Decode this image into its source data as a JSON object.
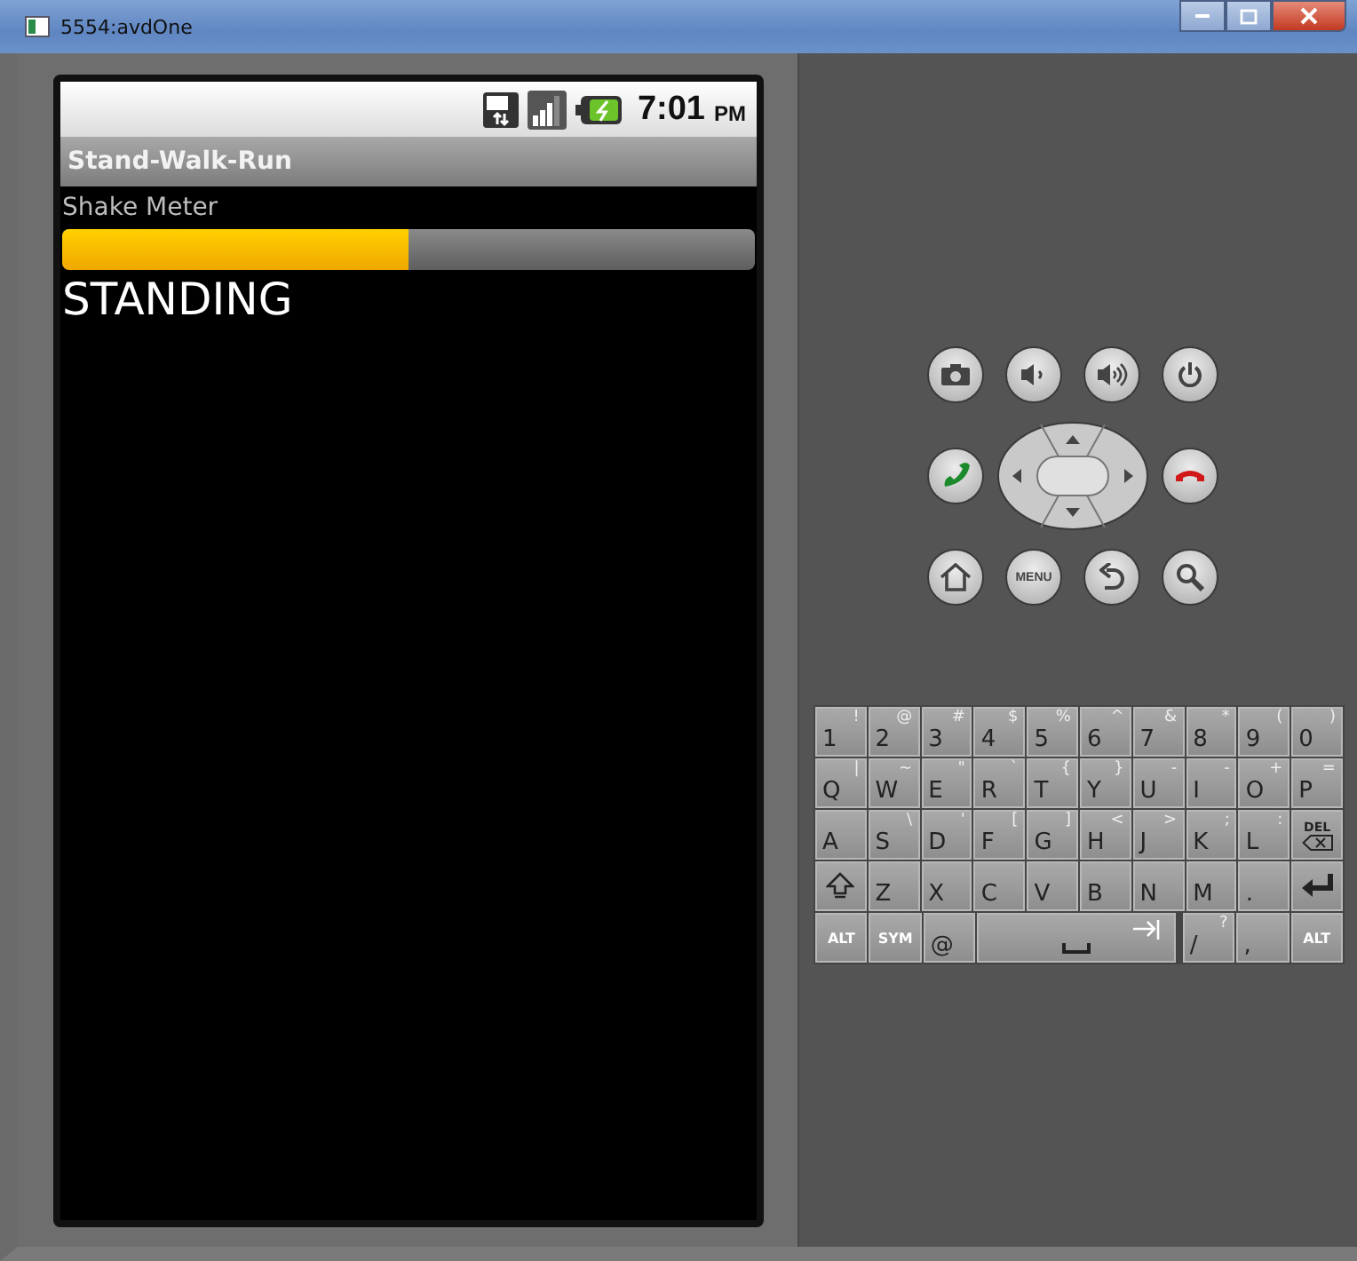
{
  "window": {
    "title": "5554:avdOne"
  },
  "status_bar": {
    "time": "7:01",
    "period": "PM"
  },
  "app_bar": {
    "title": "Stand-Walk-Run"
  },
  "meter": {
    "label": "Shake Meter",
    "level": 0.5
  },
  "activity": "STANDING",
  "hardware_keys": [
    {
      "kind": "camera"
    },
    {
      "kind": "volume_down"
    },
    {
      "kind": "volume_up"
    },
    {
      "kind": "power"
    },
    {
      "kind": "call"
    },
    {
      "kind": "dpad"
    },
    {
      "kind": "end_call"
    },
    {
      "kind": "home"
    },
    {
      "kind": "menu",
      "label": "MENU"
    },
    {
      "kind": "back"
    },
    {
      "kind": "search"
    }
  ],
  "keyboard": {
    "rows": [
      [
        {
          "kind": "char",
          "main": "1",
          "alt": "!"
        },
        {
          "kind": "char",
          "main": "2",
          "alt": "@"
        },
        {
          "kind": "char",
          "main": "3",
          "alt": "#"
        },
        {
          "kind": "char",
          "main": "4",
          "alt": "$"
        },
        {
          "kind": "char",
          "main": "5",
          "alt": "%"
        },
        {
          "kind": "char",
          "main": "6",
          "alt": "^"
        },
        {
          "kind": "char",
          "main": "7",
          "alt": "&"
        },
        {
          "kind": "char",
          "main": "8",
          "alt": "*"
        },
        {
          "kind": "char",
          "main": "9",
          "alt": "("
        },
        {
          "kind": "char",
          "main": "0",
          "alt": ")"
        }
      ],
      [
        {
          "kind": "char",
          "main": "Q",
          "alt": "|"
        },
        {
          "kind": "char",
          "main": "W",
          "alt": "~"
        },
        {
          "kind": "char",
          "main": "E",
          "alt": "\""
        },
        {
          "kind": "char",
          "main": "R",
          "alt": "`"
        },
        {
          "kind": "char",
          "main": "T",
          "alt": "{"
        },
        {
          "kind": "char",
          "main": "Y",
          "alt": "}"
        },
        {
          "kind": "char",
          "main": "U",
          "alt": "-"
        },
        {
          "kind": "char",
          "main": "I",
          "alt": "-"
        },
        {
          "kind": "char",
          "main": "O",
          "alt": "+"
        },
        {
          "kind": "char",
          "main": "P",
          "alt": "="
        }
      ],
      [
        {
          "kind": "char",
          "main": "A"
        },
        {
          "kind": "char",
          "main": "S",
          "alt": "\\"
        },
        {
          "kind": "char",
          "main": "D",
          "alt": "'"
        },
        {
          "kind": "char",
          "main": "F",
          "alt": "["
        },
        {
          "kind": "char",
          "main": "G",
          "alt": "]"
        },
        {
          "kind": "char",
          "main": "H",
          "alt": "<"
        },
        {
          "kind": "char",
          "main": "J",
          "alt": ">"
        },
        {
          "kind": "char",
          "main": "K",
          "alt": ";"
        },
        {
          "kind": "char",
          "main": "L",
          "alt": ":"
        },
        {
          "kind": "del",
          "label": "DEL"
        }
      ],
      [
        {
          "kind": "shift"
        },
        {
          "kind": "char",
          "main": "Z"
        },
        {
          "kind": "char",
          "main": "X"
        },
        {
          "kind": "char",
          "main": "C"
        },
        {
          "kind": "char",
          "main": "V"
        },
        {
          "kind": "char",
          "main": "B"
        },
        {
          "kind": "char",
          "main": "N"
        },
        {
          "kind": "char",
          "main": "M"
        },
        {
          "kind": "char",
          "main": "."
        },
        {
          "kind": "enter"
        }
      ]
    ],
    "bottom_row": [
      {
        "kind": "mod",
        "label": "ALT"
      },
      {
        "kind": "mod",
        "label": "SYM"
      },
      {
        "kind": "char",
        "main": "@"
      },
      {
        "kind": "space"
      },
      {
        "kind": "char",
        "main": "/",
        "alt": "?"
      },
      {
        "kind": "char",
        "main": ","
      },
      {
        "kind": "mod",
        "label": "ALT"
      }
    ]
  }
}
